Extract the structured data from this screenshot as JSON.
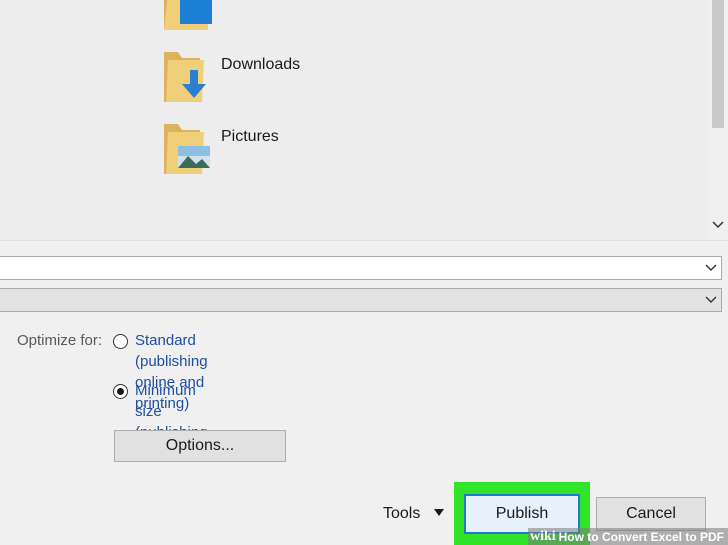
{
  "file_list": {
    "folders": [
      {
        "name": "",
        "icon": "desktop-folder-icon"
      },
      {
        "name": "Downloads",
        "icon": "downloads-folder-icon"
      },
      {
        "name": "Pictures",
        "icon": "pictures-folder-icon"
      }
    ]
  },
  "options": {
    "optimize_label": "Optimize for:",
    "standard_label": "Standard (publishing\nonline and printing)",
    "minimum_label": "Minimum size\n(publishing online)",
    "selected": "minimum",
    "options_button": "Options..."
  },
  "footer": {
    "tools_label": "Tools",
    "publish_label": "Publish",
    "cancel_label": "Cancel"
  },
  "watermark": {
    "brand": "wiki",
    "title": "How to Convert Excel to PDF"
  },
  "colors": {
    "highlight": "#30e42a",
    "link_text": "#1d4fa0",
    "folder": "#e8c46a",
    "accent_blue": "#1f78d1"
  }
}
